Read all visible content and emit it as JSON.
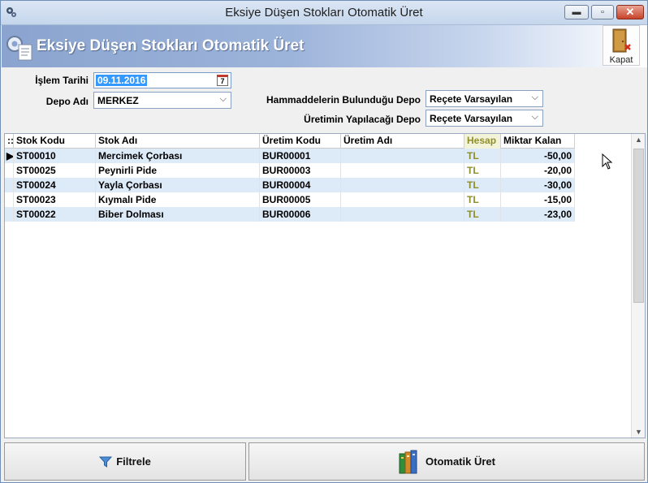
{
  "window": {
    "title": "Eksiye Düşen Stokları Otomatik Üret"
  },
  "banner": {
    "title": "Eksiye Düşen Stokları Otomatik Üret",
    "close_label": "Kapat"
  },
  "form": {
    "date_label": "İşlem Tarihi",
    "date_value": "09.11.2016",
    "calendar_day": "7",
    "depot_label": "Depo Adı",
    "depot_value": "MERKEZ",
    "raw_depot_label": "Hammaddelerin Bulunduğu Depo",
    "raw_depot_value": "Reçete Varsayılan",
    "prod_depot_label": "Üretimin Yapılacağı Depo",
    "prod_depot_value": "Reçete Varsayılan"
  },
  "grid": {
    "columns": [
      "Stok Kodu",
      "Stok Adı",
      "Üretim Kodu",
      "Üretim Adı",
      "Hesap",
      "Miktar Kalan"
    ],
    "rows": [
      [
        "ST00010",
        "Mercimek Çorbası",
        "BUR00001",
        "",
        "TL",
        "-50,00"
      ],
      [
        "ST00025",
        "Peynirli Pide",
        "BUR00003",
        "",
        "TL",
        "-20,00"
      ],
      [
        "ST00024",
        "Yayla Çorbası",
        "BUR00004",
        "",
        "TL",
        "-30,00"
      ],
      [
        "ST00023",
        "Kıymalı Pide",
        "BUR00005",
        "",
        "TL",
        "-15,00"
      ],
      [
        "ST00022",
        "Biber Dolması",
        "BUR00006",
        "",
        "TL",
        "-23,00"
      ]
    ]
  },
  "buttons": {
    "filter_label": "Filtrele",
    "auto_produce_label": "Otomatik Üret"
  },
  "colors": {
    "banner": "#9db4da",
    "row_alt": "#ddeaf8",
    "hesap": "#8f8f2a",
    "selection": "#3399ff"
  }
}
